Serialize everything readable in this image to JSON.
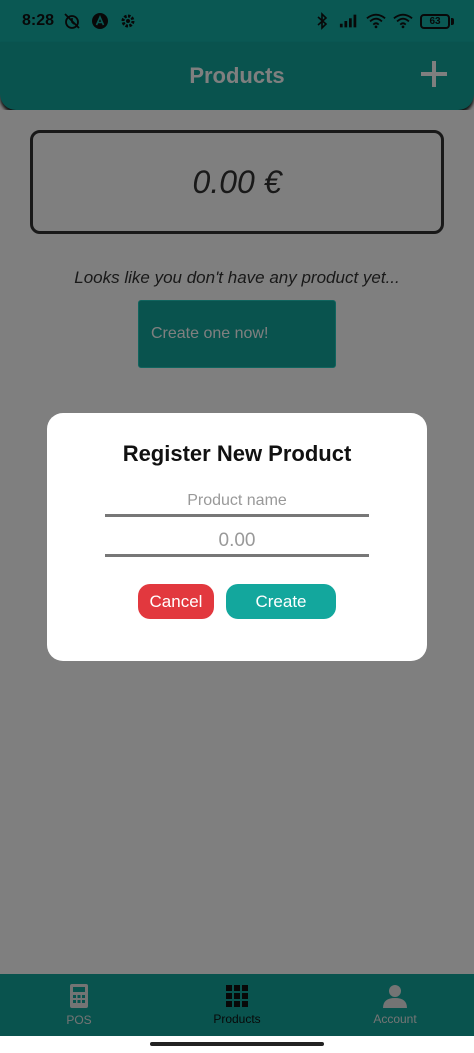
{
  "status_bar": {
    "time": "8:28",
    "battery": "63",
    "icons": [
      "alarm-off-icon",
      "app-a-icon",
      "settings-icon",
      "bluetooth-icon",
      "cellular-signal-icon",
      "wifi-icon",
      "wifi-icon",
      "battery-icon"
    ]
  },
  "app_bar": {
    "title": "Products",
    "add_icon": "plus-icon"
  },
  "main": {
    "total": "0.00 €",
    "empty_message": "Looks like you don't have any product yet...",
    "create_now_label": "Create one now!"
  },
  "dialog": {
    "title": "Register New Product",
    "name_placeholder": "Product name",
    "name_value": "",
    "price_placeholder": "0.00",
    "price_value": "",
    "cancel_label": "Cancel",
    "create_label": "Create"
  },
  "bottom_nav": {
    "items": [
      {
        "label": "POS",
        "icon": "calculator-icon"
      },
      {
        "label": "Products",
        "icon": "grid-icon"
      },
      {
        "label": "Account",
        "icon": "person-icon"
      }
    ]
  },
  "colors": {
    "primary": "#13a79d",
    "status_bar": "#14b0a6",
    "cancel": "#e2383e",
    "scrim": "rgba(0,0,0,0.5)"
  }
}
